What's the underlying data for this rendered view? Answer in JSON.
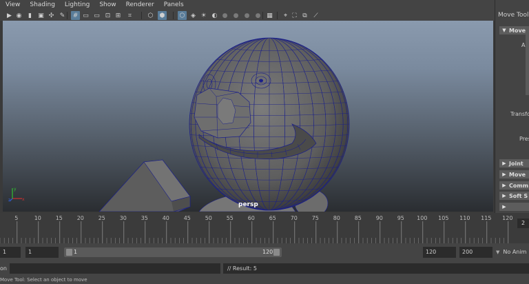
{
  "menus": [
    "View",
    "Shading",
    "Lighting",
    "Show",
    "Renderer",
    "Panels"
  ],
  "toolbar_icons": [
    {
      "name": "select-camera-icon",
      "glyph": "▶"
    },
    {
      "name": "camera-attributes-icon",
      "glyph": "◉"
    },
    {
      "name": "bookmark-icon",
      "glyph": "▮"
    },
    {
      "name": "image-plane-icon",
      "glyph": "▣"
    },
    {
      "name": "2d-pan-zoom-icon",
      "glyph": "✣"
    },
    {
      "name": "grease-pencil-icon",
      "glyph": "✎"
    },
    {
      "name": "grid-icon",
      "glyph": "#",
      "on": true
    },
    {
      "name": "film-gate-icon",
      "glyph": "▭"
    },
    {
      "name": "resolution-gate-icon",
      "glyph": "▭"
    },
    {
      "name": "gate-mask-icon",
      "glyph": "⊡"
    },
    {
      "name": "field-chart-icon",
      "glyph": "⊞"
    },
    {
      "name": "safe-action-icon",
      "glyph": "⌗"
    },
    {
      "name": "wireframe-icon",
      "glyph": "⬡"
    },
    {
      "name": "smooth-shade-icon",
      "glyph": "⬢",
      "on": true
    },
    {
      "name": "wireframe-on-shaded-icon",
      "glyph": "⬡",
      "on": true
    },
    {
      "name": "textured-icon",
      "glyph": "◈"
    },
    {
      "name": "use-all-lights-icon",
      "glyph": "☀"
    },
    {
      "name": "shadows-icon",
      "glyph": "◐"
    },
    {
      "name": "screen-space-ao-icon",
      "glyph": "●",
      "dim": true
    },
    {
      "name": "motion-blur-icon",
      "glyph": "●",
      "dim": true
    },
    {
      "name": "multisample-aa-icon",
      "glyph": "●",
      "dim": true
    },
    {
      "name": "depth-of-field-icon",
      "glyph": "●",
      "dim": true
    },
    {
      "name": "isolate-select-icon",
      "glyph": "▦"
    },
    {
      "name": "xray-icon",
      "glyph": "⌖"
    },
    {
      "name": "xray-joints-icon",
      "glyph": "⛶"
    },
    {
      "name": "xray-active-icon",
      "glyph": "⧉"
    },
    {
      "name": "xray-components-icon",
      "glyph": "⟋"
    }
  ],
  "viewport": {
    "camera": "persp",
    "axis_labels": {
      "x": "x",
      "y": "y",
      "z": "z"
    },
    "colors": {
      "mesh_fill": "#6a6a6a",
      "wireframe": "#1a1f8a",
      "bg_top": "#8a9aae",
      "bg_bottom": "#2a2d31"
    }
  },
  "side_panel": {
    "title": "Move Tool",
    "top_section": "Move",
    "attr_labels": [
      "Axi",
      "Transfo",
      "Pres"
    ],
    "collapsed_sections": [
      "Joint",
      "Move",
      "Comm",
      "Soft S"
    ]
  },
  "timeline": {
    "ticks": [
      5,
      10,
      15,
      20,
      25,
      30,
      35,
      40,
      45,
      50,
      55,
      60,
      65,
      70,
      75,
      80,
      85,
      90,
      95,
      100,
      105,
      110,
      115,
      120
    ],
    "current_frame": "2",
    "start": 1,
    "end": 120
  },
  "range": {
    "start_time": "1",
    "playback_start": "1",
    "slider_start": "1",
    "slider_end": "120",
    "playback_end": "120",
    "end_time": "200",
    "anim_layer": "No Anim"
  },
  "command": {
    "lang_label": "on",
    "input": "",
    "result": "// Result: 5"
  },
  "help_line": "Move Tool: Select an object to move"
}
